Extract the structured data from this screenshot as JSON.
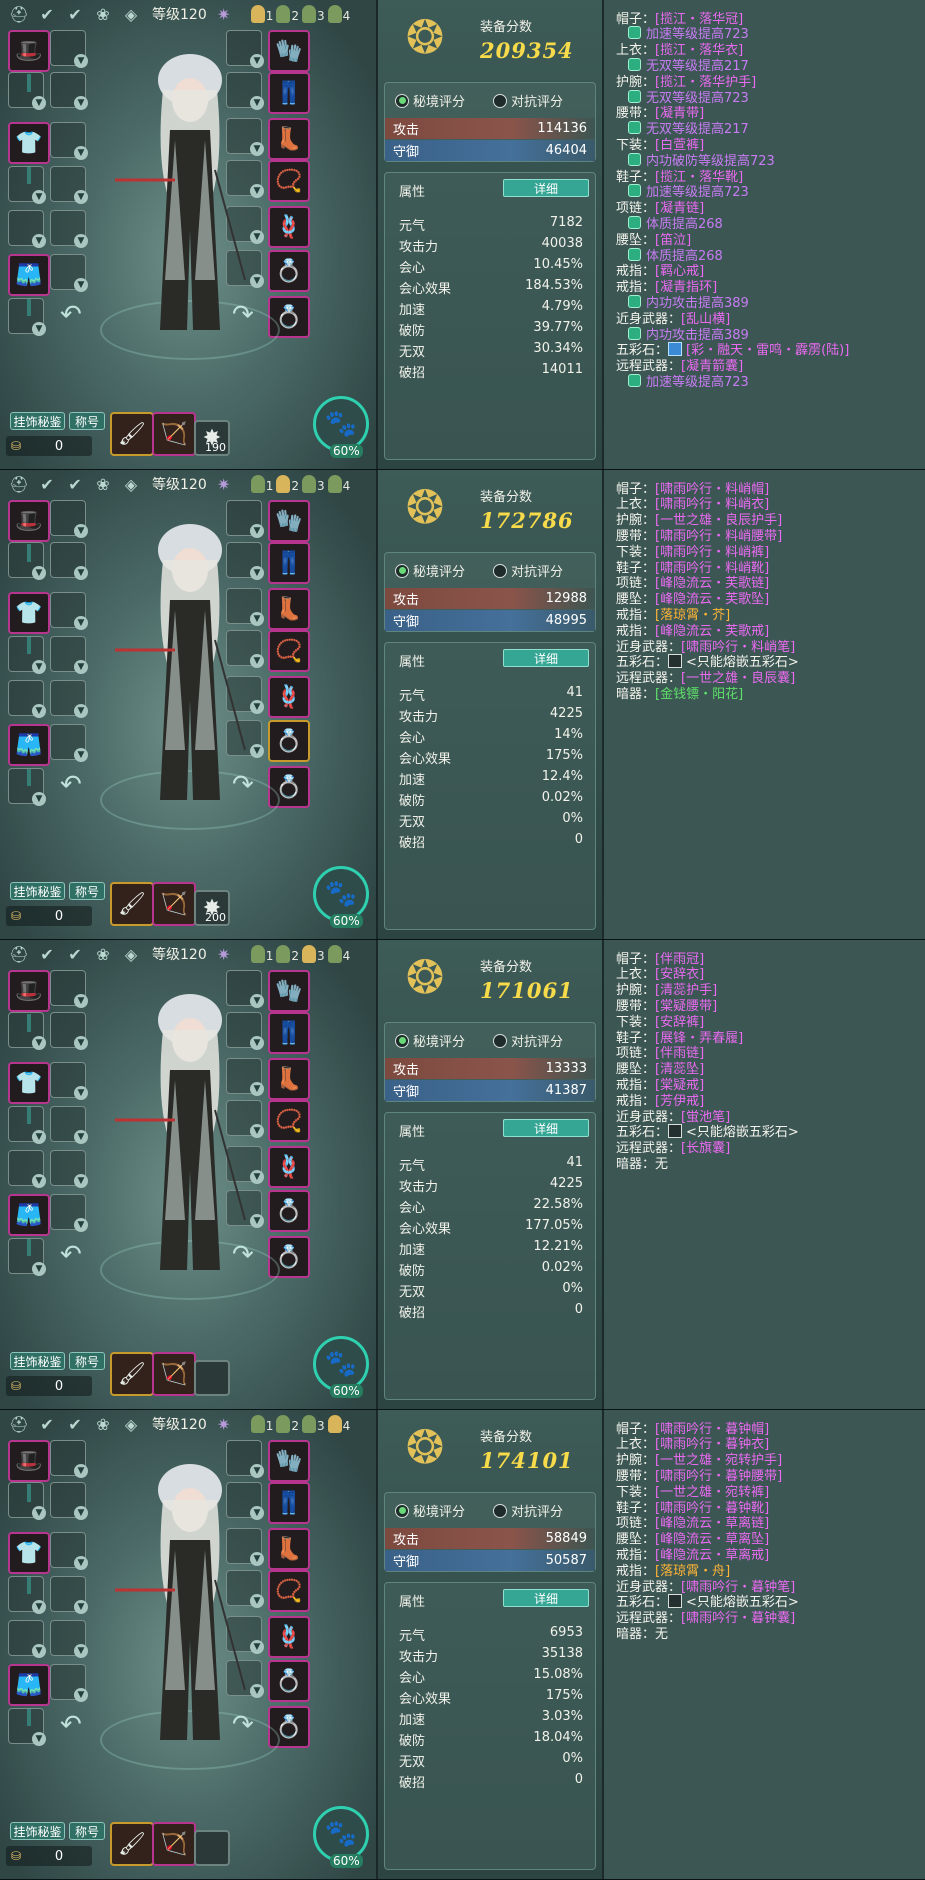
{
  "panels": [
    {
      "level": "等级120",
      "tabs": [
        "1",
        "2",
        "3",
        "4"
      ],
      "active_tab": 0,
      "hang_label": "挂饰秘鉴",
      "title_label": "称号",
      "coin": "0",
      "weapon_count": "190",
      "pet_pct": "60%",
      "score_label": "装备分数",
      "score": "209354",
      "radio_secret": "秘境评分",
      "radio_pvp": "对抗评分",
      "attack_label": "攻击",
      "attack": "114136",
      "defense_label": "守御",
      "defense": "46404",
      "attr_label": "属性",
      "detail_label": "详细",
      "attrs": [
        {
          "k": "元气",
          "v": "7182"
        },
        {
          "k": "攻击力",
          "v": "40038"
        },
        {
          "k": "会心",
          "v": "10.45%"
        },
        {
          "k": "会心效果",
          "v": "184.53%"
        },
        {
          "k": "加速",
          "v": "4.79%"
        },
        {
          "k": "破防",
          "v": "39.77%"
        },
        {
          "k": "无双",
          "v": "30.34%"
        },
        {
          "k": "破招",
          "v": "14011"
        }
      ],
      "list": [
        {
          "label": "帽子：",
          "item": "[揽江・落华冠]",
          "color": "purple"
        },
        {
          "sub": "加速等级提高723"
        },
        {
          "label": "上衣：",
          "item": "[揽江・落华衣]",
          "color": "purple"
        },
        {
          "sub": "无双等级提高217"
        },
        {
          "label": "护腕：",
          "item": "[揽江・落华护手]",
          "color": "purple"
        },
        {
          "sub": "无双等级提高723"
        },
        {
          "label": "腰带：",
          "item": "[凝青带]",
          "color": "purple"
        },
        {
          "sub": "无双等级提高217"
        },
        {
          "label": "下装：",
          "item": "[白萱裤]",
          "color": "purple"
        },
        {
          "sub": "内功破防等级提高723"
        },
        {
          "label": "鞋子：",
          "item": "[揽江・落华靴]",
          "color": "purple"
        },
        {
          "sub": "加速等级提高723"
        },
        {
          "label": "项链：",
          "item": "[凝青链]",
          "color": "purple"
        },
        {
          "sub": "体质提高268"
        },
        {
          "label": "腰坠：",
          "item": "[笛泣]",
          "color": "purple"
        },
        {
          "sub": "体质提高268"
        },
        {
          "label": "戒指：",
          "item": "[羁心戒]",
          "color": "purple"
        },
        {
          "label": "戒指：",
          "item": "[凝青指环]",
          "color": "purple"
        },
        {
          "sub": "内功攻击提高389"
        },
        {
          "label": "近身武器：",
          "item": "[乱山横]",
          "color": "purple"
        },
        {
          "sub": "内功攻击提高389"
        },
        {
          "label": "五彩石：",
          "item": "[彩・融天・雷鸣・霹雳(陆)]",
          "color": "purple",
          "gem": "blue"
        },
        {
          "label": "远程武器：",
          "item": "[凝青箭囊]",
          "color": "purple"
        },
        {
          "sub": "加速等级提高723"
        }
      ]
    },
    {
      "level": "等级120",
      "tabs": [
        "1",
        "2",
        "3",
        "4"
      ],
      "active_tab": 1,
      "hang_label": "挂饰秘鉴",
      "title_label": "称号",
      "coin": "0",
      "weapon_count": "200",
      "pet_pct": "60%",
      "score_label": "装备分数",
      "score": "172786",
      "radio_secret": "秘境评分",
      "radio_pvp": "对抗评分",
      "attack_label": "攻击",
      "attack": "12988",
      "defense_label": "守御",
      "defense": "48995",
      "attr_label": "属性",
      "detail_label": "详细",
      "attrs": [
        {
          "k": "元气",
          "v": "41"
        },
        {
          "k": "攻击力",
          "v": "4225"
        },
        {
          "k": "会心",
          "v": "14%"
        },
        {
          "k": "会心效果",
          "v": "175%"
        },
        {
          "k": "加速",
          "v": "12.4%"
        },
        {
          "k": "破防",
          "v": "0.02%"
        },
        {
          "k": "无双",
          "v": "0%"
        },
        {
          "k": "破招",
          "v": "0"
        }
      ],
      "list": [
        {
          "label": "帽子：",
          "item": "[啸雨吟行・料峭帽]",
          "color": "purple"
        },
        {
          "label": "上衣：",
          "item": "[啸雨吟行・料峭衣]",
          "color": "purple"
        },
        {
          "label": "护腕：",
          "item": "[一世之雄・良辰护手]",
          "color": "purple"
        },
        {
          "label": "腰带：",
          "item": "[啸雨吟行・料峭腰带]",
          "color": "purple"
        },
        {
          "label": "下装：",
          "item": "[啸雨吟行・料峭裤]",
          "color": "purple"
        },
        {
          "label": "鞋子：",
          "item": "[啸雨吟行・料峭靴]",
          "color": "purple"
        },
        {
          "label": "项链：",
          "item": "[峰隐流云・芙歌链]",
          "color": "purple"
        },
        {
          "label": "腰坠：",
          "item": "[峰隐流云・芙歌坠]",
          "color": "purple"
        },
        {
          "label": "戒指：",
          "item": "[落琼霄・芥]",
          "color": "orange"
        },
        {
          "label": "戒指：",
          "item": "[峰隐流云・芙歌戒]",
          "color": "purple"
        },
        {
          "label": "近身武器：",
          "item": "[啸雨吟行・料峭笔]",
          "color": "purple"
        },
        {
          "label": "五彩石：",
          "item": "<只能熔嵌五彩石>",
          "color": "plain",
          "gem": "empty"
        },
        {
          "label": "远程武器：",
          "item": "[一世之雄・良辰囊]",
          "color": "purple"
        },
        {
          "label": "暗器：",
          "item": "[金钱镖・阳花]",
          "color": "green"
        }
      ]
    },
    {
      "level": "等级120",
      "tabs": [
        "1",
        "2",
        "3",
        "4"
      ],
      "active_tab": 2,
      "hang_label": "挂饰秘鉴",
      "title_label": "称号",
      "coin": "0",
      "weapon_count": "",
      "pet_pct": "60%",
      "score_label": "装备分数",
      "score": "171061",
      "radio_secret": "秘境评分",
      "radio_pvp": "对抗评分",
      "attack_label": "攻击",
      "attack": "13333",
      "defense_label": "守御",
      "defense": "41387",
      "attr_label": "属性",
      "detail_label": "详细",
      "attrs": [
        {
          "k": "元气",
          "v": "41"
        },
        {
          "k": "攻击力",
          "v": "4225"
        },
        {
          "k": "会心",
          "v": "22.58%"
        },
        {
          "k": "会心效果",
          "v": "177.05%"
        },
        {
          "k": "加速",
          "v": "12.21%"
        },
        {
          "k": "破防",
          "v": "0.02%"
        },
        {
          "k": "无双",
          "v": "0%"
        },
        {
          "k": "破招",
          "v": "0"
        }
      ],
      "list": [
        {
          "label": "帽子：",
          "item": "[伴雨冠]",
          "color": "purple"
        },
        {
          "label": "上衣：",
          "item": "[安辞衣]",
          "color": "purple"
        },
        {
          "label": "护腕：",
          "item": "[清蕊护手]",
          "color": "purple"
        },
        {
          "label": "腰带：",
          "item": "[棠疑腰带]",
          "color": "purple"
        },
        {
          "label": "下装：",
          "item": "[安辞裤]",
          "color": "purple"
        },
        {
          "label": "鞋子：",
          "item": "[展锋・弄春履]",
          "color": "purple"
        },
        {
          "label": "项链：",
          "item": "[伴雨链]",
          "color": "purple"
        },
        {
          "label": "腰坠：",
          "item": "[清蕊坠]",
          "color": "purple"
        },
        {
          "label": "戒指：",
          "item": "[棠疑戒]",
          "color": "purple"
        },
        {
          "label": "戒指：",
          "item": "[芳伊戒]",
          "color": "purple"
        },
        {
          "label": "近身武器：",
          "item": "[蛍池笔]",
          "color": "purple"
        },
        {
          "label": "五彩石：",
          "item": "<只能熔嵌五彩石>",
          "color": "plain",
          "gem": "empty"
        },
        {
          "label": "远程武器：",
          "item": "[长旗囊]",
          "color": "purple"
        },
        {
          "label": "暗器：",
          "item": "无",
          "color": "plain"
        }
      ]
    },
    {
      "level": "等级120",
      "tabs": [
        "1",
        "2",
        "3",
        "4"
      ],
      "active_tab": 3,
      "hang_label": "挂饰秘鉴",
      "title_label": "称号",
      "coin": "0",
      "weapon_count": "",
      "pet_pct": "60%",
      "score_label": "装备分数",
      "score": "174101",
      "radio_secret": "秘境评分",
      "radio_pvp": "对抗评分",
      "attack_label": "攻击",
      "attack": "58849",
      "defense_label": "守御",
      "defense": "50587",
      "attr_label": "属性",
      "detail_label": "详细",
      "attrs": [
        {
          "k": "元气",
          "v": "6953"
        },
        {
          "k": "攻击力",
          "v": "35138"
        },
        {
          "k": "会心",
          "v": "15.08%"
        },
        {
          "k": "会心效果",
          "v": "175%"
        },
        {
          "k": "加速",
          "v": "3.03%"
        },
        {
          "k": "破防",
          "v": "18.04%"
        },
        {
          "k": "无双",
          "v": "0%"
        },
        {
          "k": "破招",
          "v": "0"
        }
      ],
      "list": [
        {
          "label": "帽子：",
          "item": "[啸雨吟行・暮钟帽]",
          "color": "purple"
        },
        {
          "label": "上衣：",
          "item": "[啸雨吟行・暮钟衣]",
          "color": "purple"
        },
        {
          "label": "护腕：",
          "item": "[一世之雄・宛转护手]",
          "color": "purple"
        },
        {
          "label": "腰带：",
          "item": "[啸雨吟行・暮钟腰带]",
          "color": "purple"
        },
        {
          "label": "下装：",
          "item": "[一世之雄・宛转裤]",
          "color": "purple"
        },
        {
          "label": "鞋子：",
          "item": "[啸雨吟行・暮钟靴]",
          "color": "purple"
        },
        {
          "label": "项链：",
          "item": "[峰隐流云・草离链]",
          "color": "purple"
        },
        {
          "label": "腰坠：",
          "item": "[峰隐流云・草离坠]",
          "color": "purple"
        },
        {
          "label": "戒指：",
          "item": "[峰隐流云・草离戒]",
          "color": "purple"
        },
        {
          "label": "戒指：",
          "item": "[落琼霄・舟]",
          "color": "orange"
        },
        {
          "label": "近身武器：",
          "item": "[啸雨吟行・暮钟笔]",
          "color": "purple"
        },
        {
          "label": "五彩石：",
          "item": "<只能熔嵌五彩石>",
          "color": "plain",
          "gem": "empty"
        },
        {
          "label": "远程武器：",
          "item": "[啸雨吟行・暮钟囊]",
          "color": "purple"
        },
        {
          "label": "暗器：",
          "item": "无",
          "color": "plain"
        }
      ]
    }
  ]
}
